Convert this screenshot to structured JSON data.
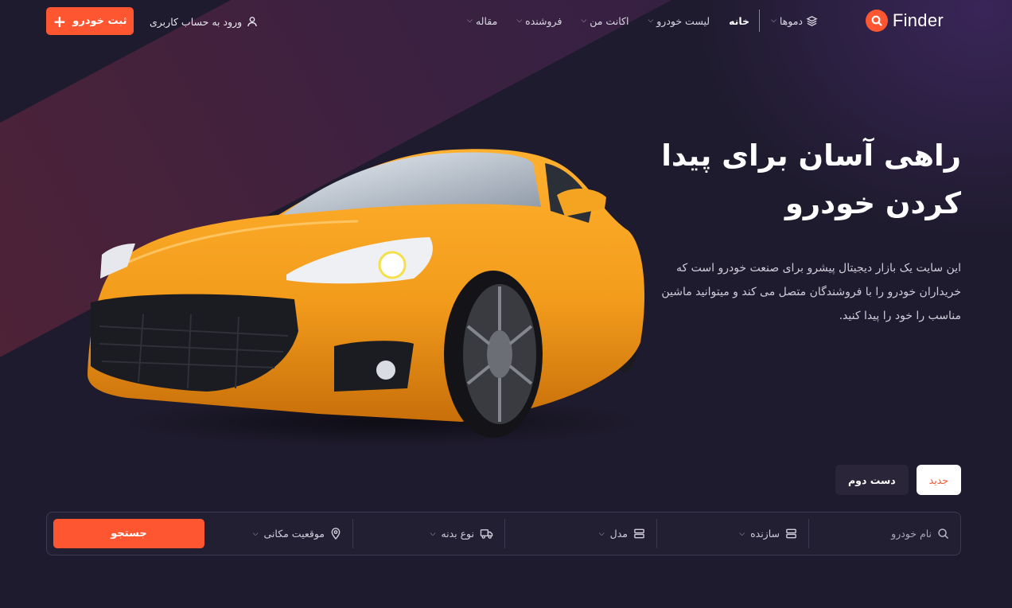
{
  "header": {
    "logo_text": "Finder",
    "nav": [
      {
        "label": "دموها",
        "icon": "layers-icon"
      },
      {
        "label": "خانه"
      },
      {
        "label": "لیست خودرو"
      },
      {
        "label": "اکانت من"
      },
      {
        "label": "فروشنده"
      },
      {
        "label": "مقاله"
      }
    ],
    "login_label": "ورود به حساب کاربری",
    "add_button_label": "ثبت خودرو"
  },
  "hero": {
    "title_line1": "راهی آسان برای پیدا",
    "title_line2": "کردن خودرو",
    "description": "این سایت یک بازار دیجیتال پیشرو برای صنعت خودرو است که خریداران خودرو را با فروشندگان متصل می کند و میتوانید ماشین مناسب را خود را پیدا کنید."
  },
  "tabs": [
    {
      "label": "جدید",
      "active": true
    },
    {
      "label": "دست دوم",
      "active": false
    }
  ],
  "search": {
    "name_placeholder": "نام خودرو",
    "make_label": "سازنده",
    "model_label": "مدل",
    "body_label": "نوع بدنه",
    "location_label": "موقعیت مکانی",
    "button_label": "جستجو"
  },
  "colors": {
    "accent": "#fd5631",
    "background": "#1f1b2e",
    "car": "#f39c1c"
  }
}
